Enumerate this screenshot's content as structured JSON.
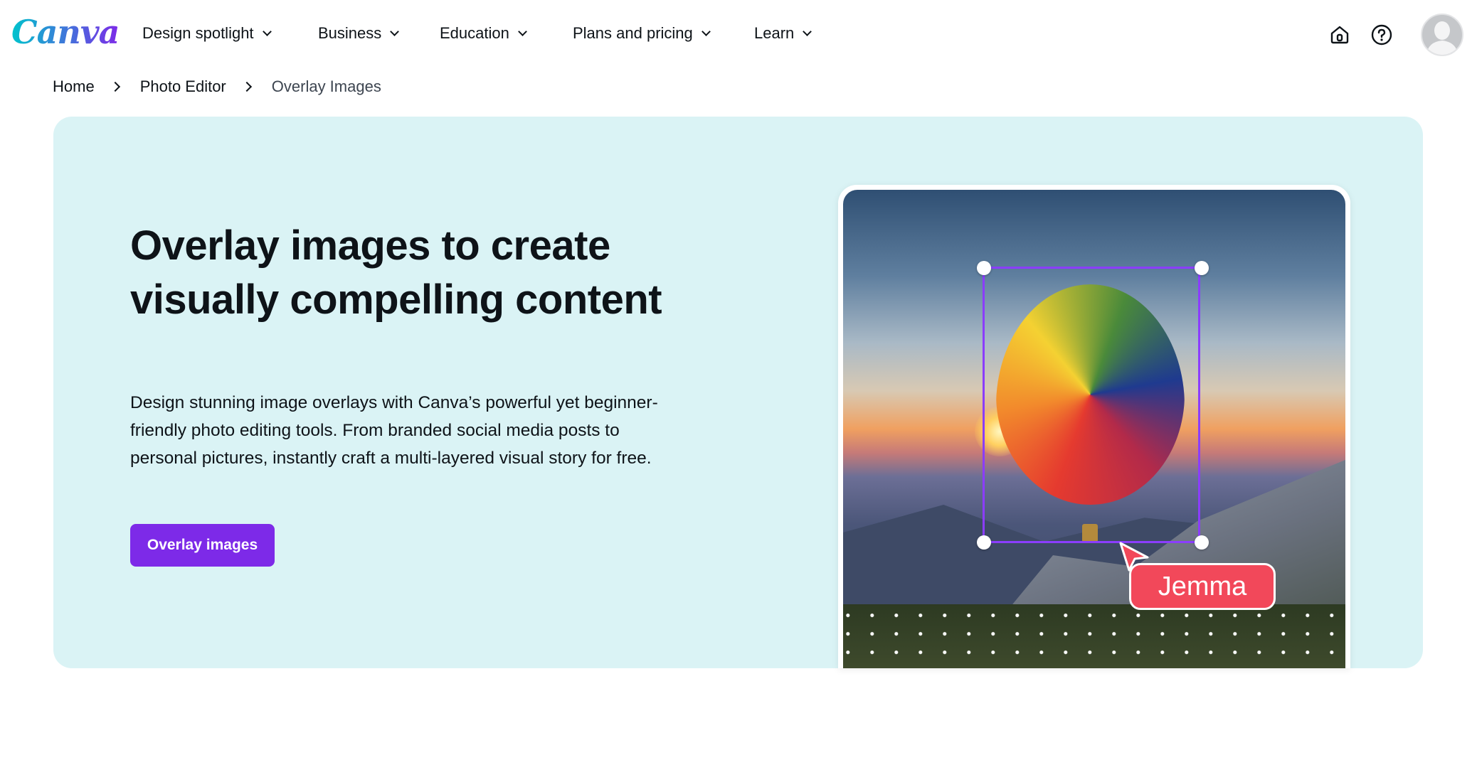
{
  "header": {
    "logo": "Canva",
    "nav": [
      {
        "label": "Design spotlight"
      },
      {
        "label": "Business"
      },
      {
        "label": "Education"
      },
      {
        "label": "Plans and pricing"
      },
      {
        "label": "Learn"
      }
    ],
    "icons": [
      "home-icon",
      "help-icon",
      "avatar"
    ]
  },
  "breadcrumb": [
    "Home",
    "Photo Editor",
    "Overlay Images"
  ],
  "hero": {
    "title": "Overlay images to create visually compelling content",
    "description": "Design stunning image overlays with Canva’s powerful yet beginner-friendly photo editing tools. From branded social media posts to personal pictures, instantly craft a multi-layered visual story for free.",
    "cta": "Overlay images",
    "collaborator_tag": "Jemma",
    "colors": {
      "accent": "#7d2ae8",
      "hero_bg": "#daf3f5",
      "selection": "#8b3dff",
      "tag": "#f2485a"
    }
  }
}
